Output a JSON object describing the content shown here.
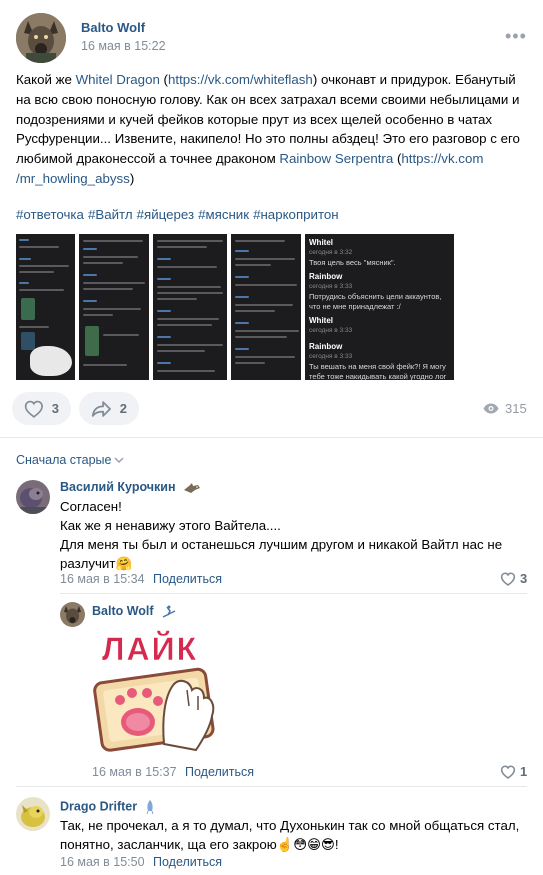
{
  "post": {
    "author": "Balto Wolf",
    "date": "16 мая в 15:22",
    "more_icon": "more-icon",
    "text": {
      "p1": "Какой же ",
      "link1": "Whitel Dragon",
      "p2": " (",
      "url1": "https://vk.com/whiteflash",
      "p3": ") очконавт и придурок. Ебанутый на всю свою поносную голову. Как он всех затрахал всеми своими небылицами и подозрениями и кучей фейков которые прут из всех щелей особенно в чатах Русфуренции... Извените, накипело! Но это полны абздец! Это его разговор с его любимой драконессой а точнее драконом ",
      "link2": "Rainbow Serpentra",
      "p4": " (",
      "url2": "https://vk.com /mr_howling_abyss",
      "p5": ")"
    },
    "hashtags": [
      "#ответочка",
      "#Вайтл",
      "#яйцерез",
      "#мясник",
      "#наркопритон"
    ],
    "last_shot": {
      "name1": "Whitel",
      "time1": "сегодня в 3:32",
      "msg1": "Твоя цель весь \"мясник\".",
      "name2": "Rainbow",
      "time2": "сегодня в 3:33",
      "msg2": "Потрудись объяснить цели аккаунтов, что не мне принадлежат :/",
      "name3": "Whitel",
      "time3": "сегодня в 3:33",
      "name4": "Rainbow",
      "time4": "сегодня в 3:33",
      "msg4": "Ты вешать на меня свой фейк?! Я могу тебе тоже накидывать какой угодно лог и доебаться до тебя. Слишком много Вайтл"
    },
    "likes": "3",
    "shares": "2",
    "views": "315"
  },
  "comments_sort": "Сначала старые",
  "comments": [
    {
      "name": "Василий Курочкин",
      "text_lines": [
        "Согласен!",
        "Как же я ненавижу этого Вайтела....",
        "Для меня ты был и останешься лучшим другом и никакой Вайтл нас не разлучит🤗"
      ],
      "date": "16 мая в 15:34",
      "share": "Поделиться",
      "likes": "3"
    },
    {
      "name": "Balto Wolf",
      "sticker_text": "ЛАЙК",
      "date": "16 мая в 15:37",
      "share": "Поделиться",
      "likes": "1"
    },
    {
      "name": "Drago Drifter",
      "text_lines": [
        "Так, не прочекал, а я то думал, что Духонькин так со мной общаться стал, понятно, засланчик, ща его закрою☝️😳😁😎!"
      ],
      "date": "16 мая в 15:50",
      "share": "Поделиться"
    }
  ],
  "colors": {
    "link": "#2a5885",
    "secondary": "#818c99",
    "action_bg": "#f0f2f5",
    "divider": "#e7e8ec",
    "sticker_red": "#d6294f"
  }
}
